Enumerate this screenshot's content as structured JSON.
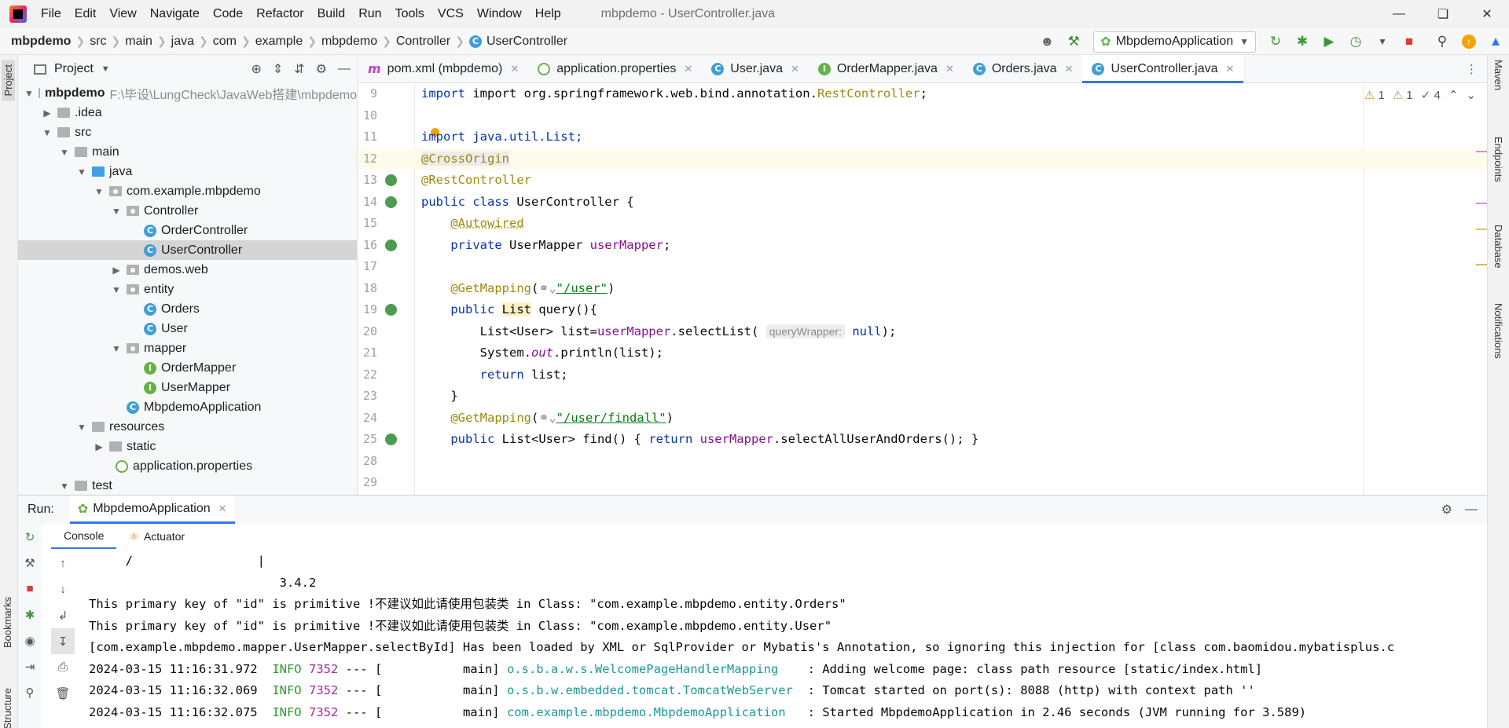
{
  "menubar": {
    "items": [
      "File",
      "Edit",
      "View",
      "Navigate",
      "Code",
      "Refactor",
      "Build",
      "Run",
      "Tools",
      "VCS",
      "Window",
      "Help"
    ],
    "window_title": "mbpdemo - UserController.java"
  },
  "breadcrumb": {
    "items": [
      "mbpdemo",
      "src",
      "main",
      "java",
      "com",
      "example",
      "mbpdemo",
      "Controller"
    ],
    "current": "UserController"
  },
  "toolbar": {
    "run_config": "MbpdemoApplication"
  },
  "left_stripe": {
    "project_tab": "Project",
    "bookmarks_tab": "Bookmarks",
    "structure_tab": "Structure"
  },
  "right_stripe": {
    "tabs": [
      "Maven",
      "Endpoints",
      "Database",
      "Notifications"
    ]
  },
  "project": {
    "title": "Project",
    "tree": [
      {
        "label": "mbpdemo",
        "path": "F:\\毕设\\LungCheck\\JavaWeb搭建\\mbpdemo"
      },
      {
        "label": ".idea"
      },
      {
        "label": "src"
      },
      {
        "label": "main"
      },
      {
        "label": "java"
      },
      {
        "label": "com.example.mbpdemo"
      },
      {
        "label": "Controller"
      },
      {
        "label": "OrderController"
      },
      {
        "label": "UserController"
      },
      {
        "label": "demos.web"
      },
      {
        "label": "entity"
      },
      {
        "label": "Orders"
      },
      {
        "label": "User"
      },
      {
        "label": "mapper"
      },
      {
        "label": "OrderMapper"
      },
      {
        "label": "UserMapper"
      },
      {
        "label": "MbpdemoApplication"
      },
      {
        "label": "resources"
      },
      {
        "label": "static"
      },
      {
        "label": "application.properties"
      },
      {
        "label": "test"
      }
    ]
  },
  "editor_tabs": [
    {
      "label": "pom.xml (mbpdemo)",
      "icon": "m"
    },
    {
      "label": "application.properties",
      "icon": "spring"
    },
    {
      "label": "User.java",
      "icon": "C"
    },
    {
      "label": "OrderMapper.java",
      "icon": "I"
    },
    {
      "label": "Orders.java",
      "icon": "C"
    },
    {
      "label": "UserController.java",
      "icon": "C"
    }
  ],
  "editor": {
    "status": {
      "warn1": "1",
      "warn2": "1",
      "ok": "4"
    },
    "lines": [
      {
        "n": "9",
        "a": "import org.springframework.web.bind.annotation.",
        "b": "RestController",
        "c": ";"
      },
      {
        "n": "10"
      },
      {
        "n": "11",
        "a": "import java.util.List;"
      },
      {
        "n": "12",
        "ann": "@CrossOrigin"
      },
      {
        "n": "13",
        "ann": "@RestController"
      },
      {
        "n": "14",
        "kw": "public class ",
        "a": "UserController {"
      },
      {
        "n": "15",
        "ann": "@Autowired"
      },
      {
        "n": "16",
        "kw": "private ",
        "a": "UserMapper ",
        "fld": "userMapper",
        "c": ";"
      },
      {
        "n": "17"
      },
      {
        "n": "18",
        "ann": "@GetMapping",
        "a": "(",
        "str": "\"/user\"",
        "c": ")"
      },
      {
        "n": "19",
        "kw": "public ",
        "a": "List",
        "b": " query(){"
      },
      {
        "n": "20",
        "a": "List<User> list=",
        "fld": "userMapper",
        "b": ".selectList(",
        "hint": "queryWrapper:",
        "kw": "null",
        "c": ");"
      },
      {
        "n": "21",
        "a": "System.",
        "fld": "out",
        "b": ".println(list);"
      },
      {
        "n": "22",
        "kw": "return ",
        "a": "list;"
      },
      {
        "n": "23",
        "a": "}"
      },
      {
        "n": "24",
        "ann": "@GetMapping",
        "a": "(",
        "str": "\"/user/findall\"",
        "c": ")"
      },
      {
        "n": "25",
        "kw": "public ",
        "a": "List<User> find() { ",
        "kw2": "return ",
        "fld": "userMapper",
        "b": ".selectAllUserAndOrders(); }"
      },
      {
        "n": "28"
      },
      {
        "n": "29"
      }
    ]
  },
  "run": {
    "label": "Run:",
    "tab": "MbpdemoApplication",
    "subtabs": [
      "Console",
      "Actuator"
    ],
    "console": [
      {
        "text": "     /                 |"
      },
      {
        "text": "                          3.4.2"
      },
      {
        "text": "This primary key of \"id\" is primitive !不建议如此请使用包装类 in Class: \"com.example.mbpdemo.entity.Orders\""
      },
      {
        "text": "This primary key of \"id\" is primitive !不建议如此请使用包装类 in Class: \"com.example.mbpdemo.entity.User\""
      },
      {
        "text": "[com.example.mbpdemo.mapper.UserMapper.selectById] Has been loaded by XML or SqlProvider or Mybatis's Annotation, so ignoring this injection for [class com.baomidou.mybatisplus.c"
      },
      {
        "ts": "2024-03-15 11:16:31.972",
        "level": "INFO",
        "pid": "7352",
        "mid": " --- [           main] ",
        "logger": "o.s.b.a.w.s.WelcomePageHandlerMapping   ",
        "msg": " : Adding welcome page: class path resource [static/index.html]"
      },
      {
        "ts": "2024-03-15 11:16:32.069",
        "level": "INFO",
        "pid": "7352",
        "mid": " --- [           main] ",
        "logger": "o.s.b.w.embedded.tomcat.TomcatWebServer ",
        "msg": " : Tomcat started on port(s): 8088 (http) with context path ''"
      },
      {
        "ts": "2024-03-15 11:16:32.075",
        "level": "INFO",
        "pid": "7352",
        "mid": " --- [           main] ",
        "logger": "com.example.mbpdemo.MbpdemoApplication  ",
        "msg": " : Started MbpdemoApplication in 2.46 seconds (JVM running for 3.589)"
      }
    ]
  }
}
